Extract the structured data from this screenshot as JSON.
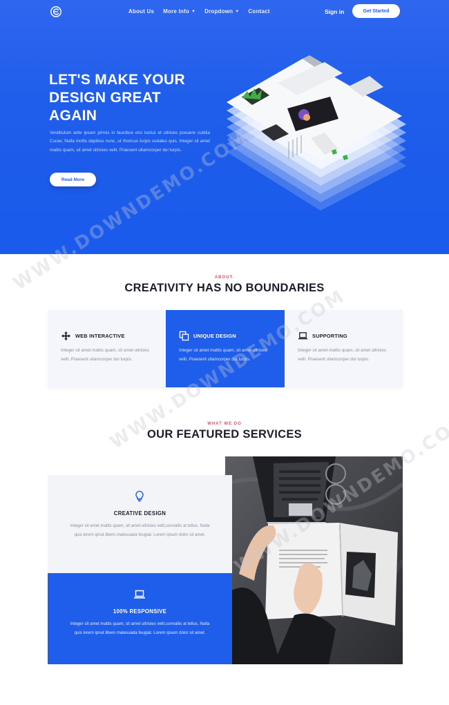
{
  "nav": {
    "links": [
      {
        "label": "About Us"
      },
      {
        "label": "More Info"
      },
      {
        "label": "Dropdown"
      },
      {
        "label": "Contact"
      }
    ],
    "signin_label": "Sign in",
    "cta_label": "Get Started"
  },
  "hero": {
    "title_lines": [
      "LET'S MAKE YOUR",
      "DESIGN GREAT",
      "AGAIN"
    ],
    "text": "Vestibulum ante ipsum primis in faucibus orci luctus et ultrices posuere cubilia Curae; Nulla mollis dapibus nunc, ut rhoncus turpis sodales quis. Integer sit amet mattis quam, sit amet ultricies velit. Praesent ullamcorper dui turpis.",
    "button_label": "Read More"
  },
  "about": {
    "kicker": "ABOUT.",
    "title": "CREATIVITY HAS NO BOUNDARIES",
    "features": [
      {
        "title": "WEB INTERACTIVE",
        "icon": "move-icon",
        "text": "Integer sit amet mattis quam, sit amet ultricies velit. Praesent ullamcorper dui turpis."
      },
      {
        "title": "UNIQUE DESIGN",
        "icon": "layers-icon",
        "text": "Integer sit amet mattis quam, sit amet ultricies velit. Praesent ullamcorper dui turpis."
      },
      {
        "title": "SUPPORTING",
        "icon": "laptop-icon",
        "text": "Integer sit amet mattis quam, sit amet ultricies velit. Praesent ullamcorper dui turpis."
      }
    ]
  },
  "services": {
    "kicker": "WHAT WE DO",
    "title": "OUR FEATURED SERVICES",
    "items": [
      {
        "title": "CREATIVE DESIGN",
        "icon": "lightbulb-icon",
        "text": "Integer sit amet mattis quam, sit amet ultricies velit,convallis at tellus. Nulla quis lorem ipnut libero malesuada feugiat. Lorem ipsum dolor sit amet."
      },
      {
        "title": "100% RESPONSIVE",
        "icon": "laptop-icon",
        "text": "Integer sit amet mattis quam, sit amet ultricies velit,convallis at tellus. Nulla quis lorem ipnut libero malesuada feugiat. Lorem ipsum dolor sit amet."
      }
    ]
  },
  "watermark": "WWW.DOWNDEMO.COM",
  "colors": {
    "primary": "#1f5eea",
    "accent": "#ef476f",
    "dark": "#1b1d2a",
    "muted": "#8a8f9c"
  }
}
